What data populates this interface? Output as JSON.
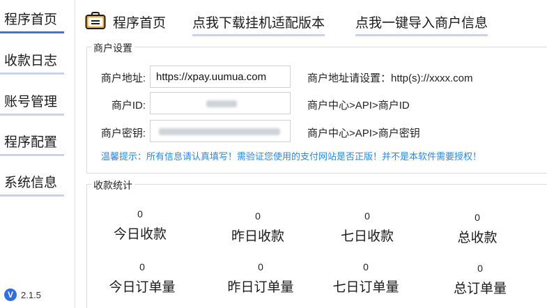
{
  "sidebar": {
    "items": [
      {
        "label": "程序首页",
        "active": true
      },
      {
        "label": "收款日志"
      },
      {
        "label": "账号管理"
      },
      {
        "label": "程序配置"
      },
      {
        "label": "系统信息"
      }
    ],
    "version_logo": "V",
    "version": "2.1.5"
  },
  "header": {
    "icon": "briefcase-icon",
    "title": "程序首页",
    "link_download": "点我下载挂机适配版本",
    "link_import": "点我一键导入商户信息"
  },
  "merchant": {
    "group_title": "商户设置",
    "address_label": "商户地址:",
    "address_value": "https://xpay.uumua.com",
    "address_hint": "商户地址请设置：http(s)://xxxx.com",
    "id_label": "商户ID:",
    "id_hint": "商户中心>API>商户ID",
    "key_label": "商户密钥:",
    "key_hint": "商户中心>API>商户密钥",
    "tip": "温馨提示：所有信息请认真填写！需验证您使用的支付网站是否正版！并不是本软件需要授权！"
  },
  "stats": {
    "group_title": "收款统计",
    "items": [
      {
        "label": "今日收款",
        "value": "0"
      },
      {
        "label": "昨日收款",
        "value": "0"
      },
      {
        "label": "七日收款",
        "value": "0"
      },
      {
        "label": "总收款",
        "value": "0"
      },
      {
        "label": "今日订单量",
        "value": "0"
      },
      {
        "label": "昨日订单量",
        "value": "0"
      },
      {
        "label": "七日订单量",
        "value": "0"
      },
      {
        "label": "总订单量",
        "value": "0"
      }
    ]
  },
  "colors": {
    "accent": "#4a6fd3",
    "underline": "#c9d2ec",
    "tip": "#2e86d8"
  }
}
